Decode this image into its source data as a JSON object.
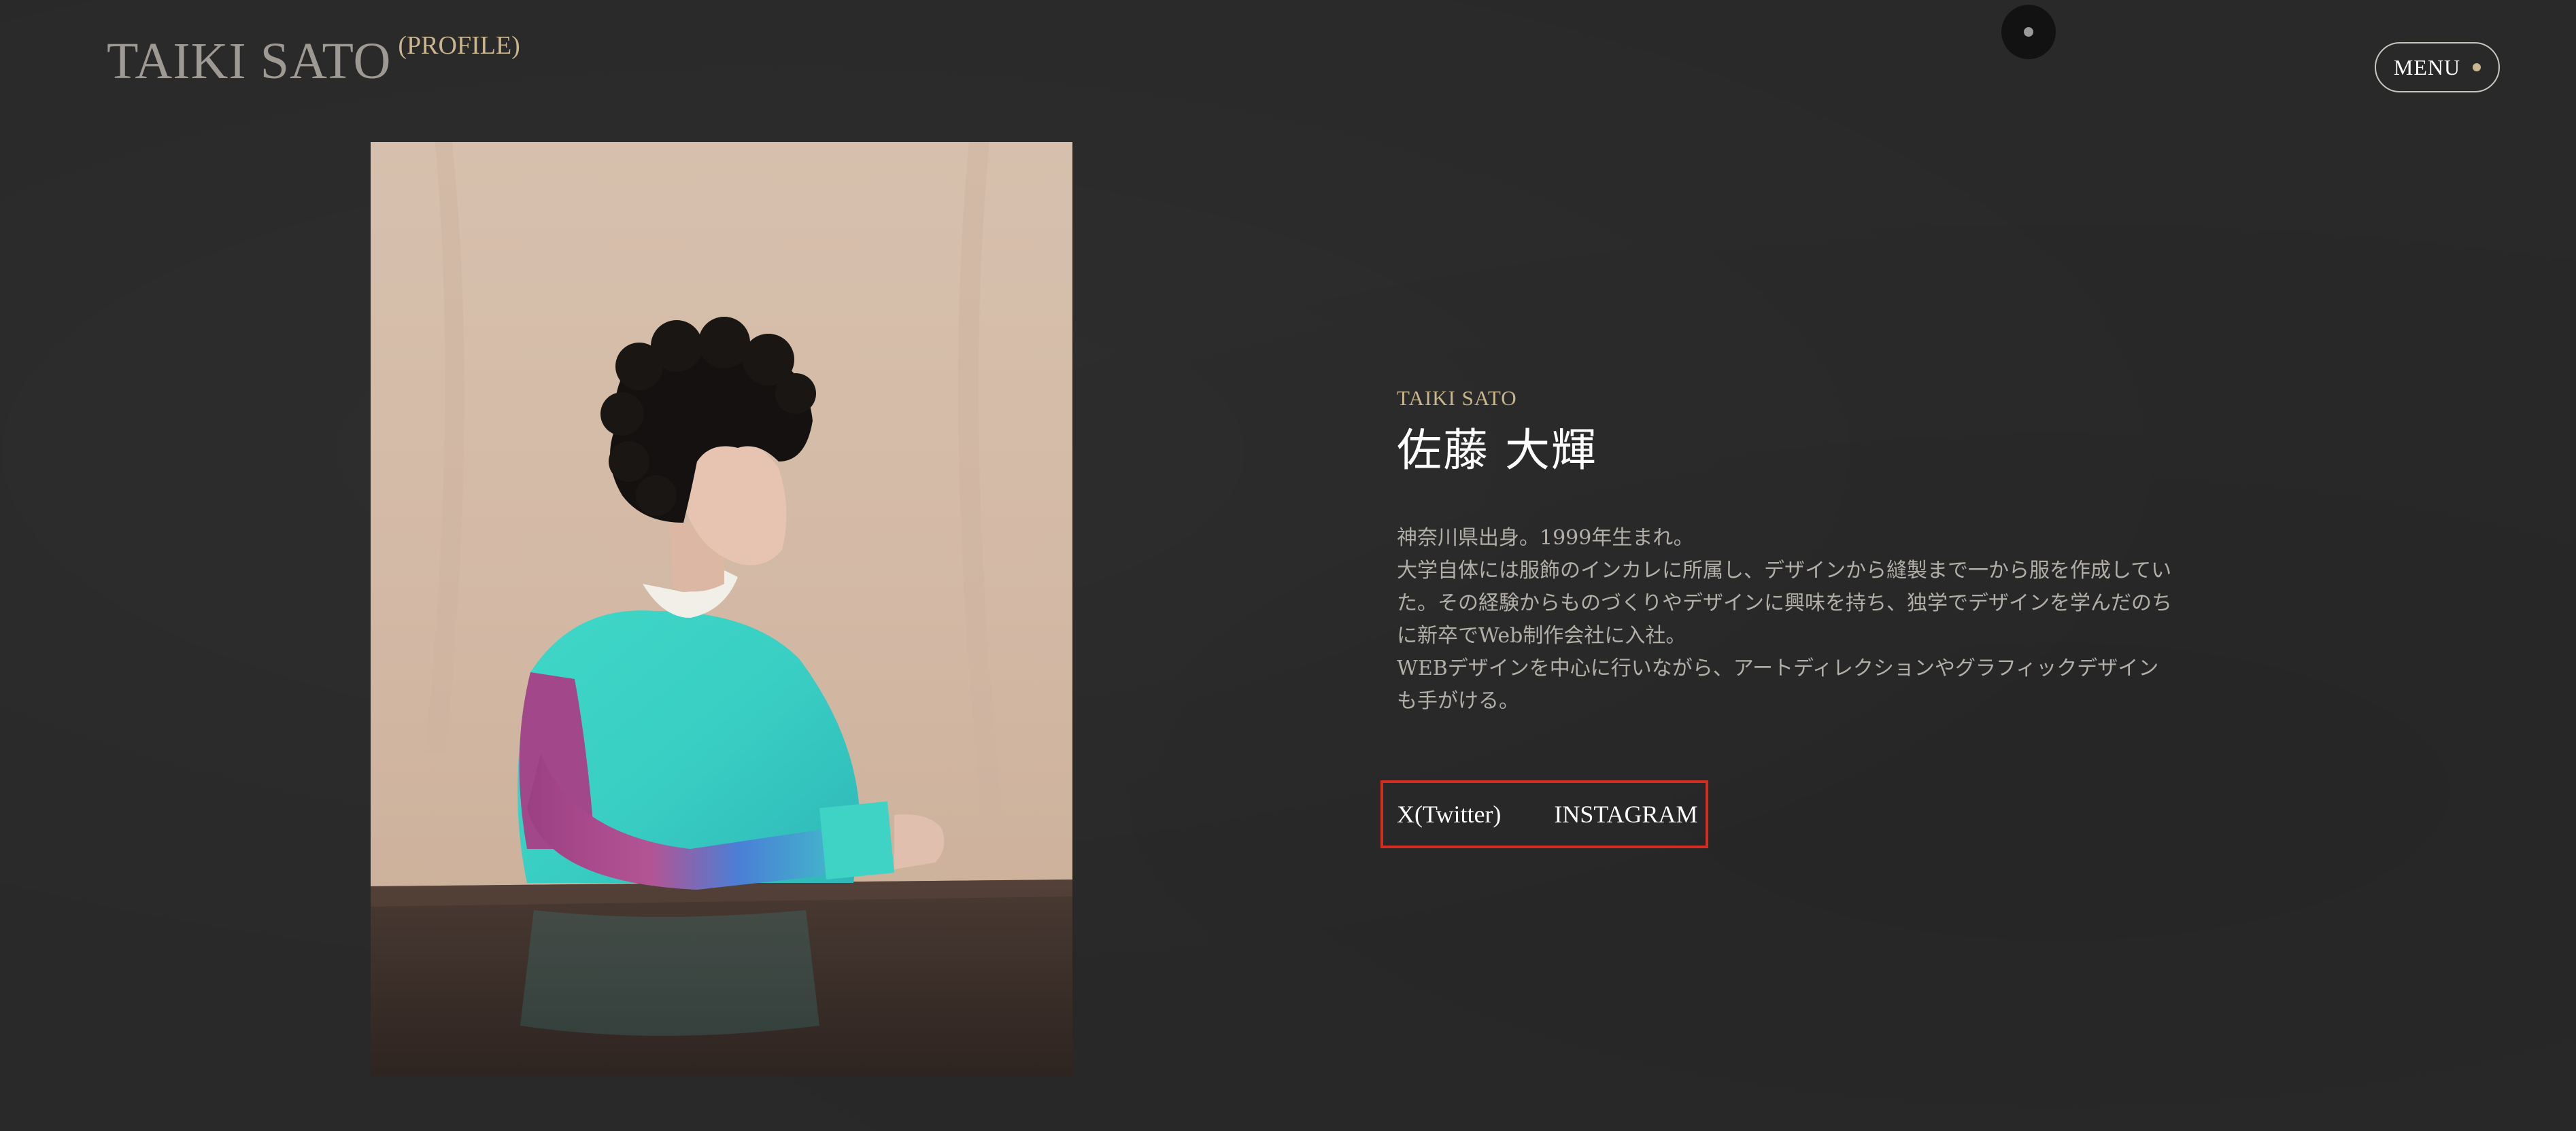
{
  "header": {
    "brand_name": "TAIKI SATO",
    "brand_suffix": "(PROFILE)",
    "menu_label": "MENU"
  },
  "profile": {
    "romaji_name": "TAIKI SATO",
    "name": "佐藤 大輝",
    "bio": [
      "神奈川県出身。1999年生まれ。",
      "大学自体には服飾のインカレに所属し、デザインから縫製まで一から服を作成してい",
      "た。その経験からものづくりやデザインに興味を持ち、独学でデザインを学んだのち",
      "に新卒でWeb制作会社に入社。",
      "WEBデザインを中心に行いながら、アートディレクションやグラフィックデザイン",
      "も手がける。"
    ]
  },
  "social": {
    "twitter_label": "X(Twitter)",
    "instagram_label": "INSTAGRAM"
  },
  "colors": {
    "background": "#292929",
    "accent_gold": "#c9b68e",
    "highlight_red": "#d22c23"
  }
}
